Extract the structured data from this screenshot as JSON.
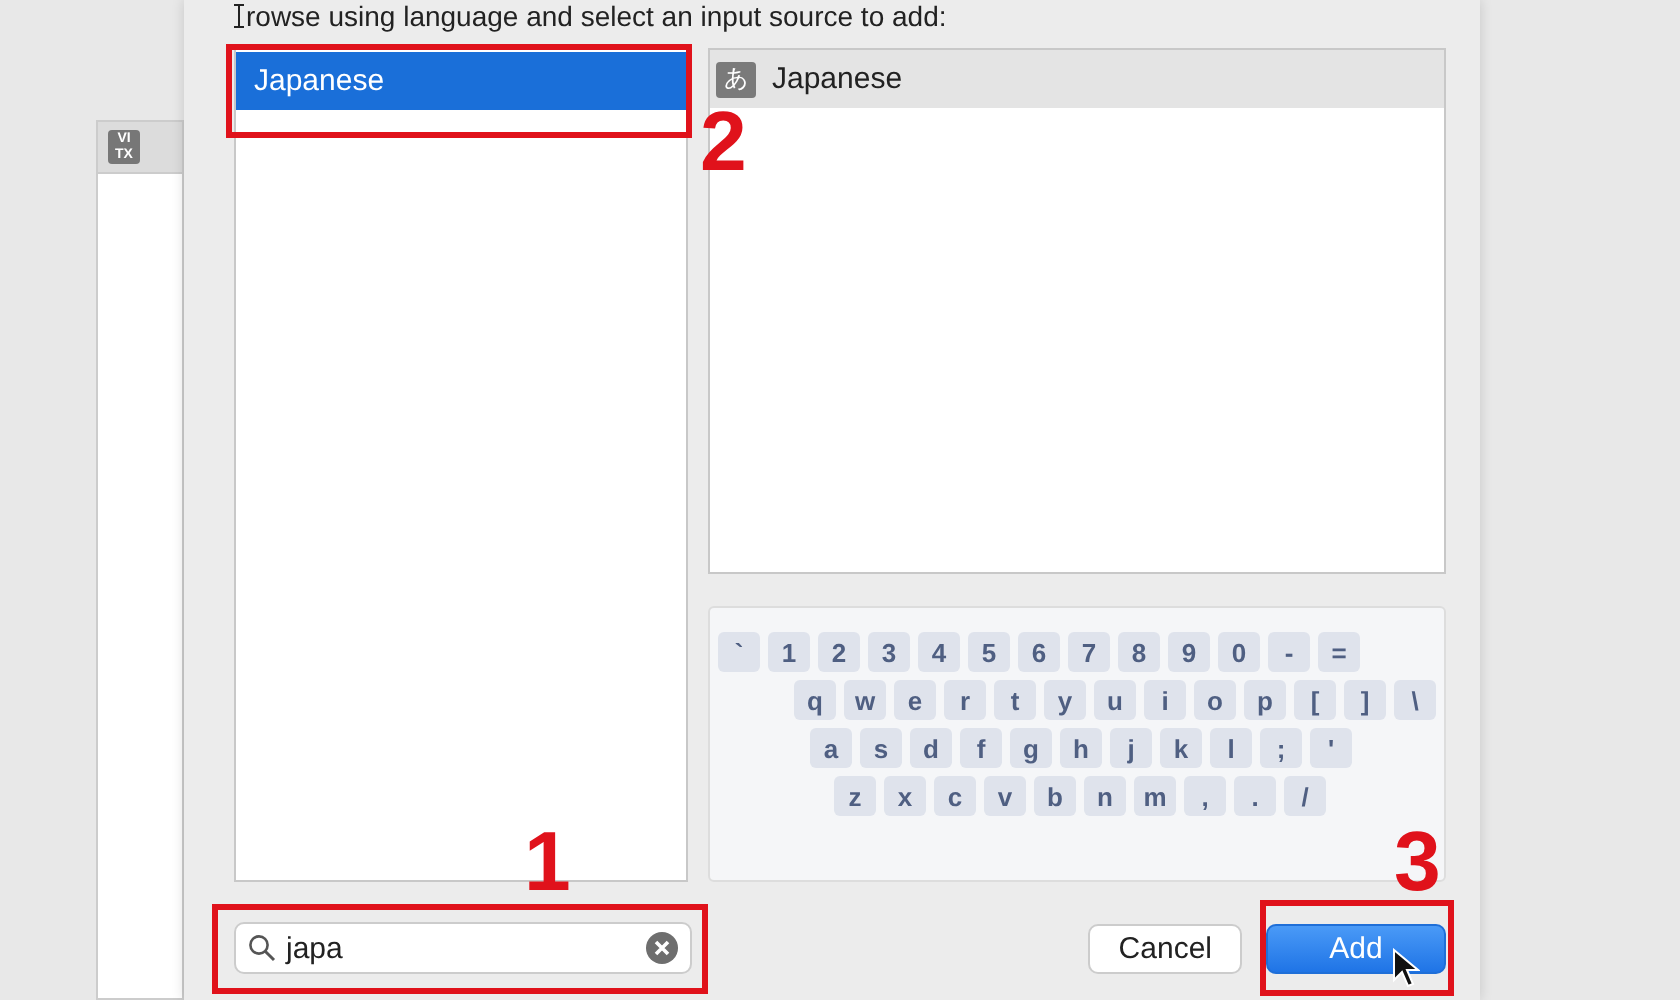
{
  "background_window": {
    "icon_lines": [
      "VI",
      "TX"
    ]
  },
  "dialog": {
    "heading": "rowse using language and select an input source to add:",
    "languages": [
      {
        "label": "Japanese",
        "selected": true
      }
    ],
    "sources": [
      {
        "label": "Japanese",
        "icon_text": "あ",
        "selected": false
      }
    ],
    "keyboard": [
      [
        "`",
        "1",
        "2",
        "3",
        "4",
        "5",
        "6",
        "7",
        "8",
        "9",
        "0",
        "-",
        "="
      ],
      [
        "q",
        "w",
        "e",
        "r",
        "t",
        "y",
        "u",
        "i",
        "o",
        "p",
        "[",
        "]",
        "\\"
      ],
      [
        "a",
        "s",
        "d",
        "f",
        "g",
        "h",
        "j",
        "k",
        "l",
        ";",
        "'"
      ],
      [
        "z",
        "x",
        "c",
        "v",
        "b",
        "n",
        "m",
        ",",
        ".",
        "/"
      ]
    ],
    "search": {
      "value": "japa"
    },
    "buttons": [
      {
        "label": "Cancel",
        "kind": "secondary"
      },
      {
        "label": "Add",
        "kind": "primary"
      }
    ]
  },
  "annotations": [
    {
      "label": "2"
    },
    {
      "label": "1"
    },
    {
      "label": "3"
    }
  ]
}
